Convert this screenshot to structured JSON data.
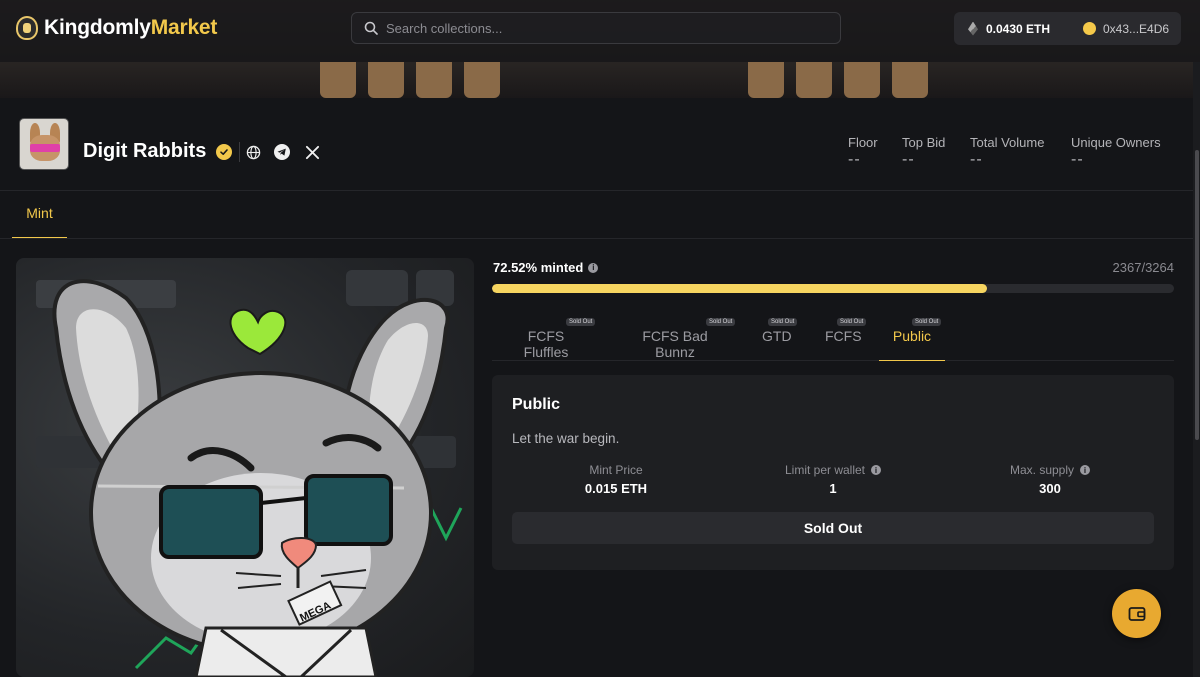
{
  "header": {
    "logo_main": "Kingdomly",
    "logo_accent": "Market",
    "search_placeholder": "Search collections...",
    "balance": "0.0430 ETH",
    "address": "0x43...E4D6"
  },
  "collection": {
    "name": "Digit Rabbits",
    "stats": [
      {
        "label": "Floor",
        "value": "--"
      },
      {
        "label": "Top Bid",
        "value": "--"
      },
      {
        "label": "Total Volume",
        "value": "--"
      },
      {
        "label": "Unique Owners",
        "value": "--"
      }
    ],
    "tab": "Mint"
  },
  "artwork": {
    "pendant_text": "MEGA"
  },
  "mint": {
    "minted_label": "72.52% minted",
    "minted_fraction": 0.7252,
    "count": "2367/3264",
    "phases": [
      {
        "label": "FCFS Fluffles",
        "badge": "Sold Out"
      },
      {
        "label": "FCFS Bad Bunnz",
        "badge": "Sold Out"
      },
      {
        "label": "GTD",
        "badge": "Sold Out"
      },
      {
        "label": "FCFS",
        "badge": "Sold Out"
      },
      {
        "label": "Public",
        "badge": "Sold Out"
      }
    ],
    "active_phase": "Public",
    "card": {
      "title": "Public",
      "description": "Let the war begin.",
      "price_label": "Mint Price",
      "price_value": "0.015 ETH",
      "limit_label": "Limit per wallet",
      "limit_value": "1",
      "supply_label": "Max. supply",
      "supply_value": "300",
      "button_label": "Sold Out"
    }
  },
  "colors": {
    "accent": "#f2c84b",
    "progress": "#f6d560",
    "fab": "#e8a930"
  }
}
